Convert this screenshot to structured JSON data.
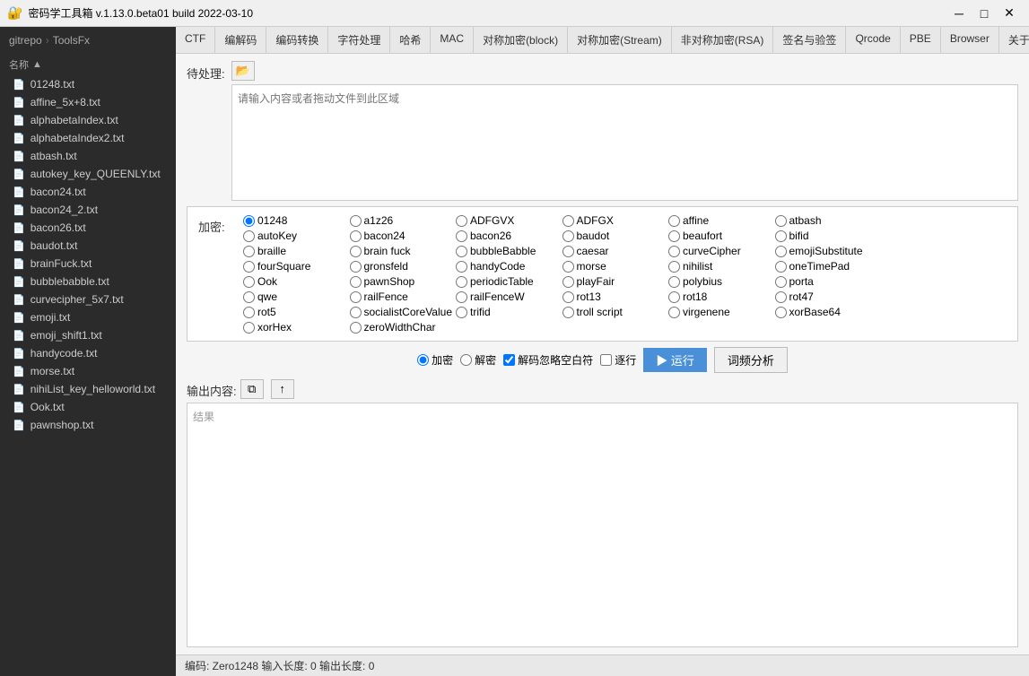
{
  "titlebar": {
    "icon": "🔐",
    "title": "密码学工具箱 v.1.13.0.beta01 build 2022-03-10",
    "minimize": "─",
    "maximize": "□",
    "close": "✕"
  },
  "sidebar": {
    "breadcrumb1": "gitrepo",
    "breadcrumb2": "ToolsFx",
    "sort_label": "名称",
    "files": [
      {
        "name": "01248.txt"
      },
      {
        "name": "affine_5x+8.txt"
      },
      {
        "name": "alphabetaIndex.txt"
      },
      {
        "name": "alphabetaIndex2.txt"
      },
      {
        "name": "atbash.txt"
      },
      {
        "name": "autokey_key_QUEENLY.txt"
      },
      {
        "name": "bacon24.txt"
      },
      {
        "name": "bacon24_2.txt"
      },
      {
        "name": "bacon26.txt"
      },
      {
        "name": "baudot.txt"
      },
      {
        "name": "brainFuck.txt"
      },
      {
        "name": "bubblebabble.txt"
      },
      {
        "name": "curvecipher_5x7.txt"
      },
      {
        "name": "emoji.txt"
      },
      {
        "name": "emoji_shift1.txt"
      },
      {
        "name": "handycode.txt"
      },
      {
        "name": "morse.txt"
      },
      {
        "name": "nihiList_key_helloworld.txt"
      },
      {
        "name": "Ook.txt"
      },
      {
        "name": "pawnshop.txt"
      }
    ]
  },
  "tabs": [
    {
      "label": "CTF",
      "active": false
    },
    {
      "label": "编解码",
      "active": false
    },
    {
      "label": "编码转换",
      "active": false
    },
    {
      "label": "字符处理",
      "active": false
    },
    {
      "label": "哈希",
      "active": false
    },
    {
      "label": "MAC",
      "active": false
    },
    {
      "label": "对称加密(block)",
      "active": false
    },
    {
      "label": "对称加密(Stream)",
      "active": false
    },
    {
      "label": "非对称加密(RSA)",
      "active": false
    },
    {
      "label": "签名与验签",
      "active": false
    },
    {
      "label": "Qrcode",
      "active": false
    },
    {
      "label": "PBE",
      "active": false
    },
    {
      "label": "Browser",
      "active": false
    },
    {
      "label": "关于",
      "active": false
    }
  ],
  "input_section": {
    "label": "待处理:",
    "placeholder": "请输入内容或者拖动文件到此区域",
    "import_icon": "📂"
  },
  "cipher_section": {
    "label": "加密:",
    "options": [
      {
        "id": "01248",
        "label": "01248",
        "checked": true
      },
      {
        "id": "a1z26",
        "label": "a1z26",
        "checked": false
      },
      {
        "id": "ADFGVX",
        "label": "ADFGVX",
        "checked": false
      },
      {
        "id": "ADFGX",
        "label": "ADFGX",
        "checked": false
      },
      {
        "id": "affine",
        "label": "affine",
        "checked": false
      },
      {
        "id": "atbash",
        "label": "atbash",
        "checked": false
      },
      {
        "id": "autoKey",
        "label": "autoKey",
        "checked": false
      },
      {
        "id": "bacon24",
        "label": "bacon24",
        "checked": false
      },
      {
        "id": "bacon26",
        "label": "bacon26",
        "checked": false
      },
      {
        "id": "baudot",
        "label": "baudot",
        "checked": false
      },
      {
        "id": "beaufort",
        "label": "beaufort",
        "checked": false
      },
      {
        "id": "bifid",
        "label": "bifid",
        "checked": false
      },
      {
        "id": "braille",
        "label": "braille",
        "checked": false
      },
      {
        "id": "brain_fuck",
        "label": "brain fuck",
        "checked": false
      },
      {
        "id": "bubbleBabble",
        "label": "bubbleBabble",
        "checked": false
      },
      {
        "id": "caesar",
        "label": "caesar",
        "checked": false
      },
      {
        "id": "curveCipher",
        "label": "curveCipher",
        "checked": false
      },
      {
        "id": "emojiSubstitute",
        "label": "emojiSubstitute",
        "checked": false
      },
      {
        "id": "fourSquare",
        "label": "fourSquare",
        "checked": false
      },
      {
        "id": "gronsfeld",
        "label": "gronsfeld",
        "checked": false
      },
      {
        "id": "handyCode",
        "label": "handyCode",
        "checked": false
      },
      {
        "id": "morse",
        "label": "morse",
        "checked": false
      },
      {
        "id": "nihilist",
        "label": "nihilist",
        "checked": false
      },
      {
        "id": "oneTimePad",
        "label": "oneTimePad",
        "checked": false
      },
      {
        "id": "Ook",
        "label": "Ook",
        "checked": false
      },
      {
        "id": "pawnShop",
        "label": "pawnShop",
        "checked": false
      },
      {
        "id": "periodicTable",
        "label": "periodicTable",
        "checked": false
      },
      {
        "id": "playFair",
        "label": "playFair",
        "checked": false
      },
      {
        "id": "polybius",
        "label": "polybius",
        "checked": false
      },
      {
        "id": "porta",
        "label": "porta",
        "checked": false
      },
      {
        "id": "qwe",
        "label": "qwe",
        "checked": false
      },
      {
        "id": "railFence",
        "label": "railFence",
        "checked": false
      },
      {
        "id": "railFenceW",
        "label": "railFenceW",
        "checked": false
      },
      {
        "id": "rot13",
        "label": "rot13",
        "checked": false
      },
      {
        "id": "rot18",
        "label": "rot18",
        "checked": false
      },
      {
        "id": "rot47",
        "label": "rot47",
        "checked": false
      },
      {
        "id": "rot5",
        "label": "rot5",
        "checked": false
      },
      {
        "id": "socialistCoreValue",
        "label": "socialistCoreValue",
        "checked": false
      },
      {
        "id": "trifid",
        "label": "trifid",
        "checked": false
      },
      {
        "id": "troll_script",
        "label": "troll script",
        "checked": false
      },
      {
        "id": "virgenene",
        "label": "virgenene",
        "checked": false
      },
      {
        "id": "xorBase64",
        "label": "xorBase64",
        "checked": false
      },
      {
        "id": "xorHex",
        "label": "xorHex",
        "checked": false
      },
      {
        "id": "zeroWidthChar",
        "label": "zeroWidthChar",
        "checked": false
      }
    ]
  },
  "action_bar": {
    "encrypt_label": "加密",
    "decrypt_label": "解密",
    "ignore_space_label": "解码忽略空白符",
    "step_label": "逐行",
    "run_label": "▶ 运行",
    "freq_label": "词频分析"
  },
  "output_section": {
    "label": "输出内容:",
    "placeholder": "结果",
    "copy_icon": "⧉",
    "upload_icon": "↑"
  },
  "statusbar": {
    "text": "编码: Zero1248  输入长度: 0  输出长度: 0"
  }
}
